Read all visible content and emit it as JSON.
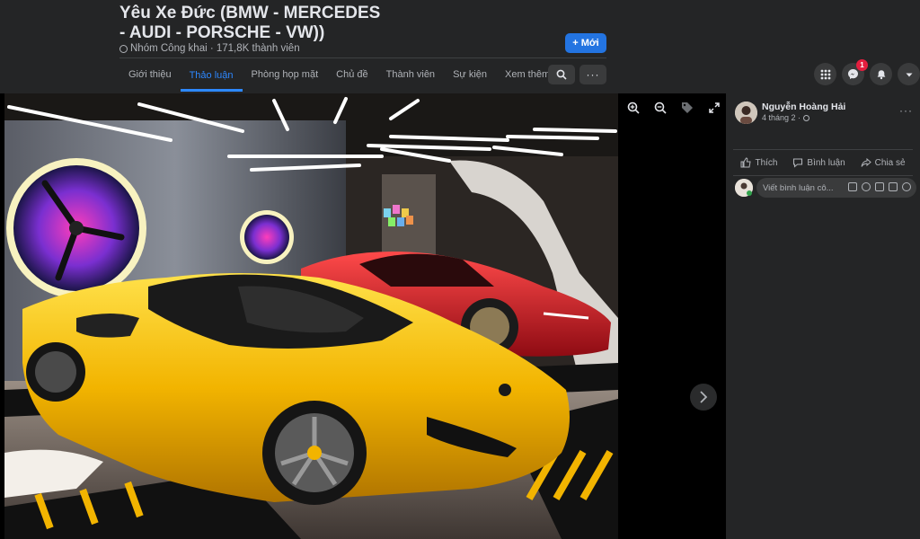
{
  "group": {
    "title": "Yêu Xe Đức (BMW - MERCEDES - AUDI - PORSCHE - VW))",
    "meta": "Nhóm Công khai · 171,8K thành viên",
    "new_button": "Mới"
  },
  "nav": {
    "tabs": [
      {
        "label": "Giới thiệu"
      },
      {
        "label": "Thảo luận",
        "active": true
      },
      {
        "label": "Phòng họp mặt"
      },
      {
        "label": "Chủ đề"
      },
      {
        "label": "Thành viên"
      },
      {
        "label": "Sự kiện"
      },
      {
        "label": "Xem thêm"
      }
    ],
    "more_dots": "···"
  },
  "top_icons": {
    "messenger_badge": "1"
  },
  "post": {
    "author": "Nguyễn Hoàng Hải",
    "time": "4 tháng 2 ·",
    "more_dots": "···",
    "actions": {
      "like": "Thích",
      "comment": "Bình luận",
      "share": "Chia sẻ"
    },
    "comment_placeholder": "Viết bình luận cô..."
  },
  "colors": {
    "accent": "#2d88ff",
    "button": "#2374e1",
    "badge": "#e41e3f",
    "header_bg": "#242526",
    "page_bg": "#18191a"
  },
  "icons": [
    "globe-icon",
    "plus-icon",
    "search-icon",
    "menu-grid-icon",
    "messenger-icon",
    "bell-icon",
    "caret-down-icon",
    "zoom-in-icon",
    "zoom-out-icon",
    "tag-icon",
    "fullscreen-icon",
    "chevron-right-icon",
    "like-icon",
    "comment-icon",
    "share-icon"
  ]
}
